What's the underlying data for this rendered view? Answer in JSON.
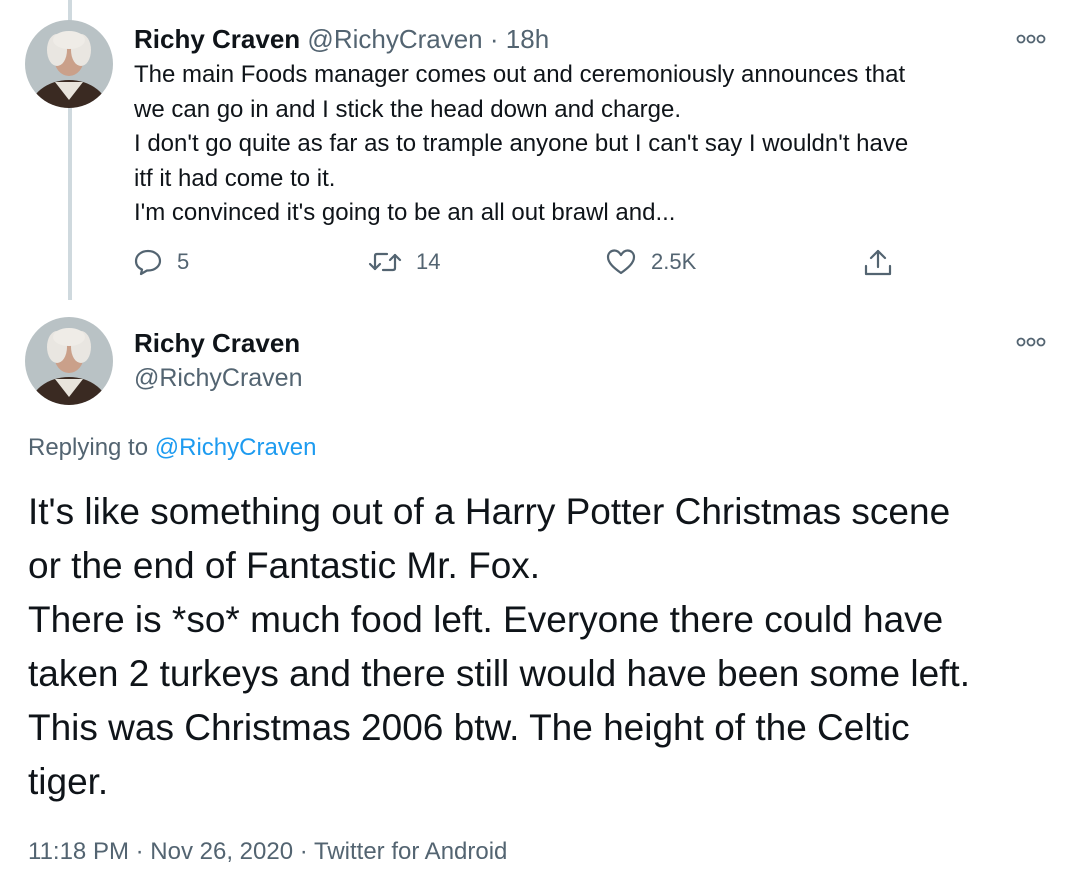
{
  "tweet1": {
    "name": "Richy Craven",
    "handle": "@RichyCraven",
    "separator": "·",
    "time": "18h",
    "lines": [
      "The main Foods manager comes out and ceremoniously announces that",
      "we can go in and I stick the head down and charge.",
      "I don't go quite as far as to trample anyone but I can't say I wouldn't have",
      "itf it had come to it.",
      "I'm convinced it's going to be an all out brawl and..."
    ],
    "actions": {
      "reply_count": "5",
      "retweet_count": "14",
      "like_count": "2.5K"
    }
  },
  "tweet2": {
    "name": "Richy Craven",
    "handle": "@RichyCraven",
    "replying_prefix": "Replying to",
    "replying_handle": "@RichyCraven",
    "lines": [
      "It's like something out of a Harry Potter Christmas scene",
      "or the end of Fantastic Mr. Fox.",
      "There is *so* much food left. Everyone there could have",
      "taken 2 turkeys and there still would have been some left.",
      "This was Christmas 2006 btw. The height of the Celtic",
      "tiger."
    ],
    "meta": {
      "time": "11:18 PM",
      "sep1": "·",
      "date": "Nov 26, 2020",
      "sep2": "·",
      "source": "Twitter for Android"
    }
  },
  "icons": {
    "reply": "reply-icon",
    "retweet": "retweet-icon",
    "like": "heart-icon",
    "share": "share-icon",
    "more": "more-icon"
  },
  "colors": {
    "text": "#0f1419",
    "muted": "#536471",
    "link": "#1d9bf0",
    "thread_line": "#cfd9de"
  }
}
